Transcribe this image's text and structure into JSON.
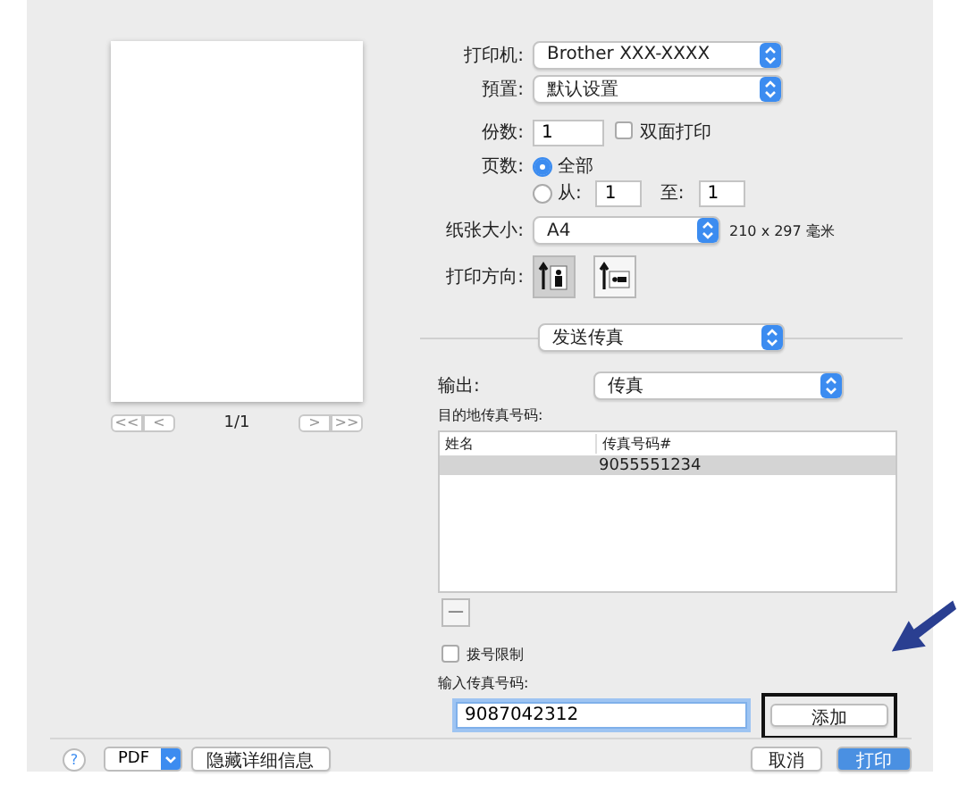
{
  "preview": {
    "nav_buttons": [
      "<<",
      "<",
      ">",
      ">>"
    ],
    "page_indicator": "1/1"
  },
  "print_settings": {
    "printer": {
      "label": "打印机:",
      "value": "Brother XXX-XXXX"
    },
    "presets": {
      "label": "預置:",
      "value": "默认设置"
    },
    "copies": {
      "label": "份数:",
      "value": "1",
      "duplex": {
        "label": "双面打印",
        "checked": false
      }
    },
    "pages": {
      "label": "页数:",
      "options": [
        {
          "label": "全部",
          "selected": true
        },
        {
          "label": "从:",
          "selected": false
        }
      ],
      "from": "1",
      "to_label": "至:",
      "to": "1"
    },
    "paper_size": {
      "label": "纸张大小:",
      "value": "A4",
      "dimensions": "210 x 297 毫米"
    },
    "orientation": {
      "label": "打印方向:",
      "options": [
        {
          "kind": "portrait",
          "selected": true
        },
        {
          "kind": "landscape",
          "selected": false
        }
      ]
    }
  },
  "section_menu": {
    "value": "发送传真"
  },
  "fax": {
    "output": {
      "label": "输出:",
      "value": "传真"
    },
    "destination_label": "目的地传真号码:",
    "table": {
      "columns": [
        "姓名",
        "传真号码#"
      ],
      "rows": [
        {
          "fax_number": "9055551234",
          "selected": true
        }
      ]
    },
    "remove_button": "—",
    "dial_restriction": {
      "label": "拨号限制",
      "checked": false
    },
    "input_label": "输入传真号码:",
    "input_value": "9087042312",
    "add_button": "添加"
  },
  "footer": {
    "help": "?",
    "pdf": "PDF",
    "hide_details": "隐藏详细信息",
    "cancel": "取消",
    "print": "打印"
  }
}
